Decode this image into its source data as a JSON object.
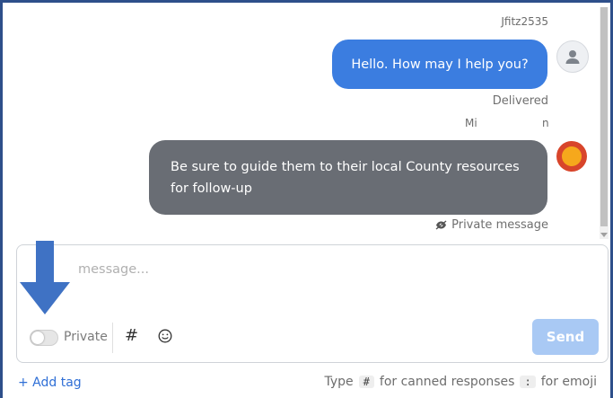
{
  "messages": [
    {
      "sender": "Jfitz2535",
      "text": "Hello. How may I help you?",
      "status": "Delivered"
    },
    {
      "sender_prefix": "Mi",
      "sender_suffix": "n",
      "text": "Be sure to guide them to their local County resources for follow-up",
      "note": "Private message"
    }
  ],
  "composer": {
    "placeholder": "message...",
    "private_label": "Private",
    "hash_symbol": "#",
    "send_label": "Send"
  },
  "footer": {
    "add_tag": "+ Add tag",
    "hint_type": "Type",
    "hint_hash_key": "#",
    "hint_canned": "for canned responses",
    "hint_colon_key": ":",
    "hint_emoji": "for emoji"
  },
  "colors": {
    "outgoing_bubble": "#3b7de0",
    "private_bubble": "#696d74",
    "send_button": "#a9c9f4",
    "arrow": "#3f72c4"
  },
  "icons": [
    "user-icon",
    "bot-avatar-icon",
    "eye-slash-icon",
    "toggle-icon",
    "hash-icon",
    "emoji-icon",
    "down-arrow-icon"
  ]
}
